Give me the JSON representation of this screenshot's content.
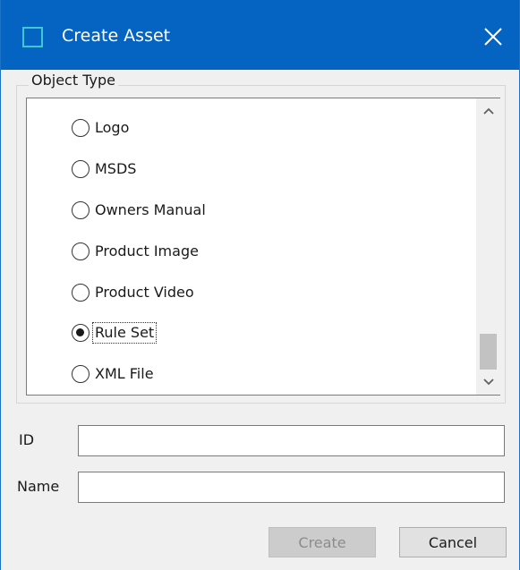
{
  "window": {
    "title": "Create Asset",
    "title_bar_color": "#0563c1",
    "icon": "app-window-icon",
    "close_icon": "close-icon"
  },
  "object_type": {
    "group_label": "Object Type",
    "options": [
      {
        "label": "Logo",
        "checked": false
      },
      {
        "label": "MSDS",
        "checked": false
      },
      {
        "label": "Owners Manual",
        "checked": false
      },
      {
        "label": "Product Image",
        "checked": false
      },
      {
        "label": "Product Video",
        "checked": false
      },
      {
        "label": "Rule Set",
        "checked": true
      },
      {
        "label": "XML File",
        "checked": false
      }
    ],
    "selected": "Rule Set",
    "scrollbar": {
      "up_icon": "chevron-up-icon",
      "down_icon": "chevron-down-icon",
      "scroll_position": 1.0
    }
  },
  "form": {
    "id_label": "ID",
    "id_value": "",
    "name_label": "Name",
    "name_value": ""
  },
  "buttons": {
    "create_label": "Create",
    "create_enabled": false,
    "cancel_label": "Cancel"
  }
}
